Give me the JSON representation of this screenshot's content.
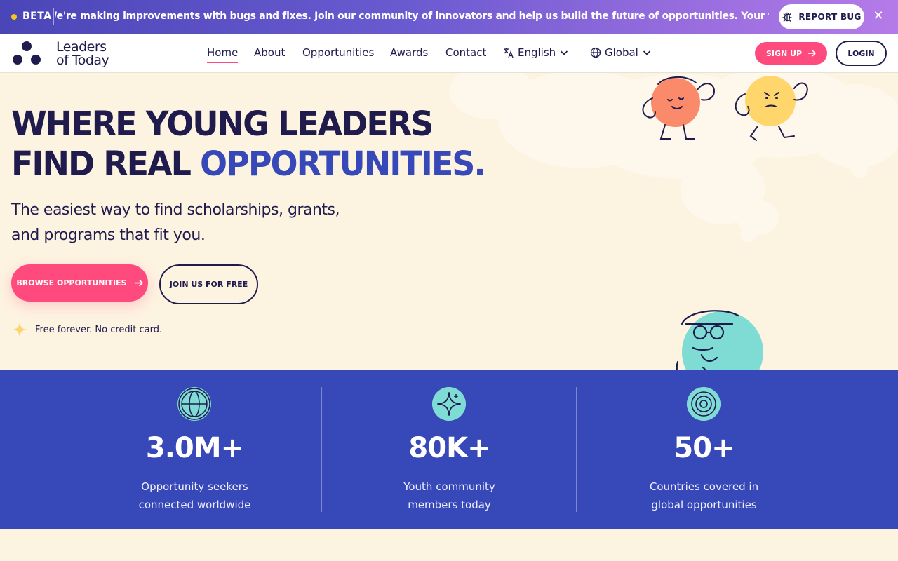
{
  "banner": {
    "beta_label": "BETA",
    "message": "We're making improvements with bugs and fixes. Join our community of innovators and help us build the future of opportunities. Your feedback matters - report bugs and",
    "report_bug_label": "REPORT BUG",
    "close_icon": "close-icon"
  },
  "nav": {
    "logo_line1": "Leaders",
    "logo_line2": "of Today",
    "links": [
      "Home",
      "About",
      "Opportunities",
      "Awards",
      "Contact"
    ],
    "active_link": "Home",
    "language_label": "English",
    "region_label": "Global",
    "signup_label": "SIGN UP",
    "login_label": "LOGIN"
  },
  "hero": {
    "title_line1": "WHERE YOUNG LEADERS",
    "title_line2_plain": "FIND REAL ",
    "title_line2_accent": "OPPORTUNITIES",
    "title_period": ".",
    "subtitle_line1": "The easiest way to find scholarships, grants,",
    "subtitle_line2": "and programs that fit you.",
    "browse_label": "BROWSE OPPORTUNITIES",
    "join_label": "JOIN US FOR FREE",
    "free_note": "Free forever. No credit card."
  },
  "stats": [
    {
      "icon": "globe-icon",
      "value": "3.0M+",
      "label_line1": "Opportunity seekers",
      "label_line2": "connected worldwide"
    },
    {
      "icon": "sparkle-icon",
      "value": "80K+",
      "label_line1": "Youth community",
      "label_line2": "members today"
    },
    {
      "icon": "target-icon",
      "value": "50+",
      "label_line1": "Countries covered in",
      "label_line2": "global opportunities"
    }
  ],
  "colors": {
    "brand_navy": "#1f1b4d",
    "accent_blue": "#3748b8",
    "accent_pink": "#ff4a7d",
    "background_cream": "#fdf3e1",
    "icon_teal": "#7fdcd4"
  }
}
